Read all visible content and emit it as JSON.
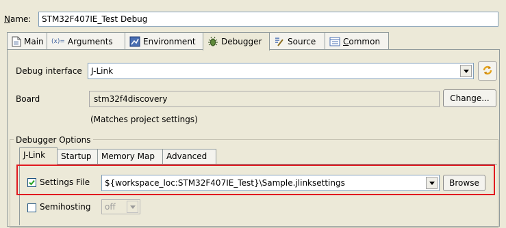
{
  "name": {
    "label": "Name:",
    "value": "STM32F407IE_Test Debug"
  },
  "tabs": [
    {
      "label": "Main",
      "icon": "document-icon"
    },
    {
      "label": "Arguments",
      "icon": "arguments-icon",
      "icon_text": "(x)="
    },
    {
      "label": "Environment",
      "icon": "environment-icon"
    },
    {
      "label": "Debugger",
      "icon": "debugger-icon",
      "active": true
    },
    {
      "label": "Source",
      "icon": "source-icon"
    },
    {
      "label": "Common",
      "icon": "common-icon"
    }
  ],
  "debug_interface": {
    "label": "Debug interface",
    "value": "J-Link"
  },
  "board": {
    "label": "Board",
    "value": "stm32f4discovery",
    "change_label": "Change...",
    "note": "(Matches project settings)"
  },
  "debugger_options": {
    "title": "Debugger Options",
    "tabs": [
      {
        "label": "J-Link",
        "active": true
      },
      {
        "label": "Startup"
      },
      {
        "label": "Memory Map"
      },
      {
        "label": "Advanced"
      }
    ],
    "settings_file": {
      "label": "Settings File",
      "checked": true,
      "value": "${workspace_loc:STM32F407IE_Test}\\Sample.jlinksettings",
      "browse_label": "Browse"
    },
    "semihosting": {
      "label": "Semihosting",
      "checked": false,
      "value": "off"
    }
  },
  "colors": {
    "highlight": "#e1191f",
    "background": "#ece9d8"
  }
}
